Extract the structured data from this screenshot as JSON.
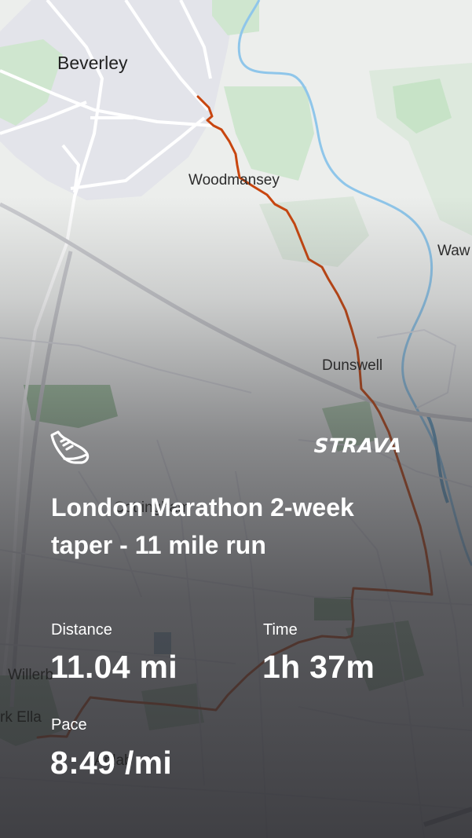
{
  "map": {
    "places": {
      "beverley": "Beverley",
      "woodmansey": "Woodmansey",
      "wawne": "Waw",
      "dunswell": "Dunswell",
      "willerby": "Willerb",
      "kirk_ella": "rk Ella",
      "cottingham": "Cottingham",
      "anlaby": "Anlab"
    },
    "route_color": "#c8460f"
  },
  "brand": {
    "name": "STRAVA",
    "icon": "running-shoe-icon"
  },
  "activity": {
    "title": "London Marathon 2-week taper - 11 mile run",
    "stats": {
      "distance_label": "Distance",
      "distance_value": "11.04 mi",
      "time_label": "Time",
      "time_value": "1h 37m",
      "pace_label": "Pace",
      "pace_value": "8:49 /mi"
    }
  }
}
